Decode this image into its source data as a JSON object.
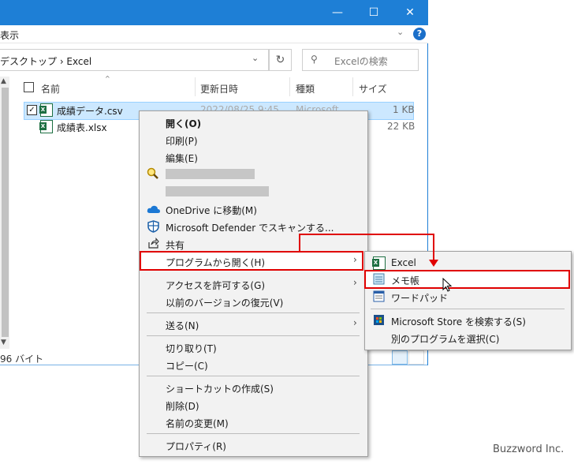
{
  "window": {
    "controls": {
      "minimize": "—",
      "maximize": "☐",
      "close": "✕"
    },
    "menu": {
      "view_tab": "表示",
      "ribbon_toggle": "⌄",
      "help": "?"
    },
    "address": {
      "path": "デスクトップ  ›  Excel",
      "dropdown": "⌄",
      "refresh": "↻"
    },
    "search": {
      "icon": "⚲",
      "placeholder": "Excelの検索"
    },
    "columns": {
      "name": "名前",
      "date": "更新日時",
      "type": "種類",
      "size": "サイズ",
      "sort": "^"
    },
    "files": [
      {
        "name": "成績データ.csv",
        "date": "2022/08/25 9:45",
        "type": "Microsoft",
        "size": "1 KB",
        "checked": "✓"
      },
      {
        "name": "成績表.xlsx",
        "size": "22 KB"
      }
    ],
    "status": "96 バイト",
    "scroll": {
      "up": "▲",
      "down": "▼"
    }
  },
  "context_menu": {
    "open": "開く(O)",
    "print": "印刷(P)",
    "edit": "編集(E)",
    "onedrive": "OneDrive に移動(M)",
    "defender": "Microsoft Defender でスキャンする...",
    "share": "共有",
    "open_with": "プログラムから開く(H)",
    "give_access": "アクセスを許可する(G)",
    "restore": "以前のバージョンの復元(V)",
    "send_to": "送る(N)",
    "cut": "切り取り(T)",
    "copy": "コピー(C)",
    "shortcut": "ショートカットの作成(S)",
    "delete": "削除(D)",
    "rename": "名前の変更(M)",
    "properties": "プロパティ(R)",
    "arrow": "›"
  },
  "submenu": {
    "excel": "Excel",
    "notepad": "メモ帳",
    "wordpad": "ワードパッド",
    "store": "Microsoft Store を検索する(S)",
    "choose": "別のプログラムを選択(C)"
  },
  "watermark": "Buzzword Inc.",
  "colors": {
    "titlebar": "#1e7fd6",
    "highlight": "#e00000",
    "selection": "#cce8ff"
  }
}
